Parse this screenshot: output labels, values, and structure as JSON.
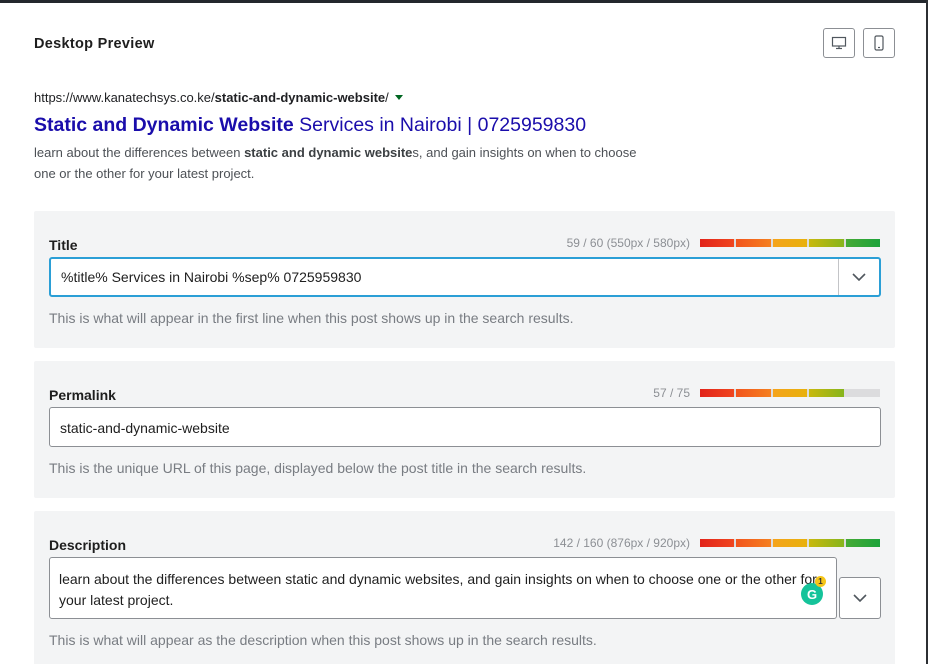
{
  "header": {
    "title": "Desktop Preview",
    "desktop_icon": "desktop-icon",
    "mobile_icon": "mobile-icon"
  },
  "serp": {
    "url_prefix": "https://www.kanatechsys.co.ke/",
    "url_slug": "static-and-dynamic-website",
    "url_suffix": "/",
    "title_bold": "Static and Dynamic Website",
    "title_rest": " Services in Nairobi | 0725959830",
    "desc_part1": "learn about the differences between ",
    "desc_bold": "static and dynamic website",
    "desc_part2": "s, and gain insights on when to choose one or the other for your latest project."
  },
  "title_panel": {
    "label": "Title",
    "counter": "59 / 60 (550px / 580px)",
    "value": "%title%  Services in Nairobi %sep% 0725959830",
    "help": "This is what will appear in the first line when this post shows up in the search results.",
    "progress": 0.98
  },
  "permalink_panel": {
    "label": "Permalink",
    "counter": "57 / 75",
    "value": "static-and-dynamic-website",
    "help": "This is the unique URL of this page, displayed below the post title in the search results.",
    "progress": 0.76
  },
  "description_panel": {
    "label": "Description",
    "counter": "142 / 160 (876px / 920px)",
    "value": "learn about the differences between static and dynamic websites, and gain insights on when to choose one or the other for your latest project.",
    "help": "This is what will appear as the description when this post shows up in the search results.",
    "progress": 0.96,
    "grammarly_count": "1"
  },
  "colors": {
    "link": "#1a0dab",
    "focus": "#2b9fd6",
    "grammarly": "#15c39a"
  }
}
